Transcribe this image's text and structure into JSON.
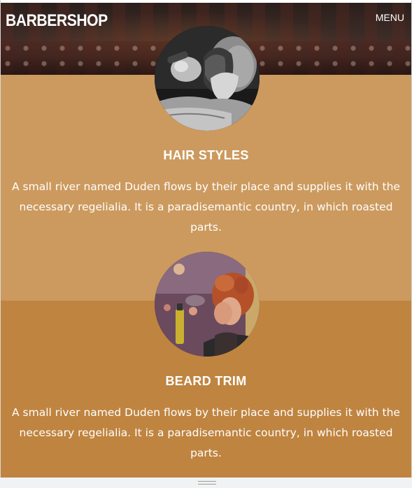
{
  "header": {
    "brand": "BARBERSHOP",
    "menu_label": "MENU"
  },
  "services": [
    {
      "title": "HAIR STYLES",
      "description": "A small river named Duden flows by their place and supplies it with the necessary regelialia. It is a paradisemantic country, in which roasted parts.",
      "background_color": "#cc9a5e",
      "photo": "barber-trimming-beard-photo"
    },
    {
      "title": "BEARD TRIM",
      "description": "A small river named Duden flows by their place and supplies it with the necessary regelialia. It is a paradisemantic country, in which roasted parts.",
      "background_color": "#bf8440",
      "photo": "woman-hairspray-photo"
    }
  ],
  "colors": {
    "text": "#ffffff",
    "hero_dark": "#2b1f1b"
  },
  "icons": {
    "resize_grip": "resize-grip-icon"
  }
}
